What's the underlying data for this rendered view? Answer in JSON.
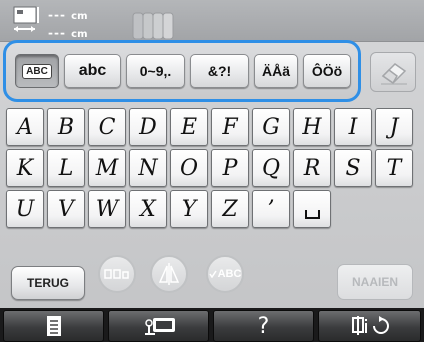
{
  "header": {
    "size_width_value": "---",
    "size_width_unit": "cm",
    "size_height_value": "---",
    "size_height_unit": "cm",
    "size_icon": "size-arrows-icon",
    "stack_icon": "layered-pages-icon"
  },
  "tabs": [
    {
      "label": "ABC",
      "selected": true
    },
    {
      "label": "abc",
      "selected": false
    },
    {
      "label": "0~9,.",
      "selected": false
    },
    {
      "label": "&?!",
      "selected": false
    },
    {
      "label": "ÄÅä",
      "selected": false
    },
    {
      "label": "ÔÖö",
      "selected": false
    }
  ],
  "eraser_icon": "eraser-icon",
  "keyboard": {
    "rows": [
      [
        "A",
        "B",
        "C",
        "D",
        "E",
        "F",
        "G",
        "H",
        "I",
        "J"
      ],
      [
        "K",
        "L",
        "M",
        "N",
        "O",
        "P",
        "Q",
        "R",
        "S",
        "T"
      ],
      [
        "U",
        "V",
        "W",
        "X",
        "Y",
        "Z",
        "’",
        "space"
      ]
    ]
  },
  "buttons": {
    "back_label": "TERUG",
    "sew_label": "NAAIEN",
    "font_preview_label": "ABC",
    "layout_icon": "layout-icon",
    "mirror_icon": "mirror-icon"
  },
  "nav": [
    {
      "icon": "document-icon"
    },
    {
      "icon": "sewing-machine-icon"
    },
    {
      "icon": "help-icon",
      "label": "?"
    },
    {
      "icon": "settings-loop-icon"
    }
  ],
  "colors": {
    "tab_group_border": "#2f8fe6",
    "navbar_bg": "#1a1a1b",
    "inactive_text": "#b7b9bc"
  }
}
